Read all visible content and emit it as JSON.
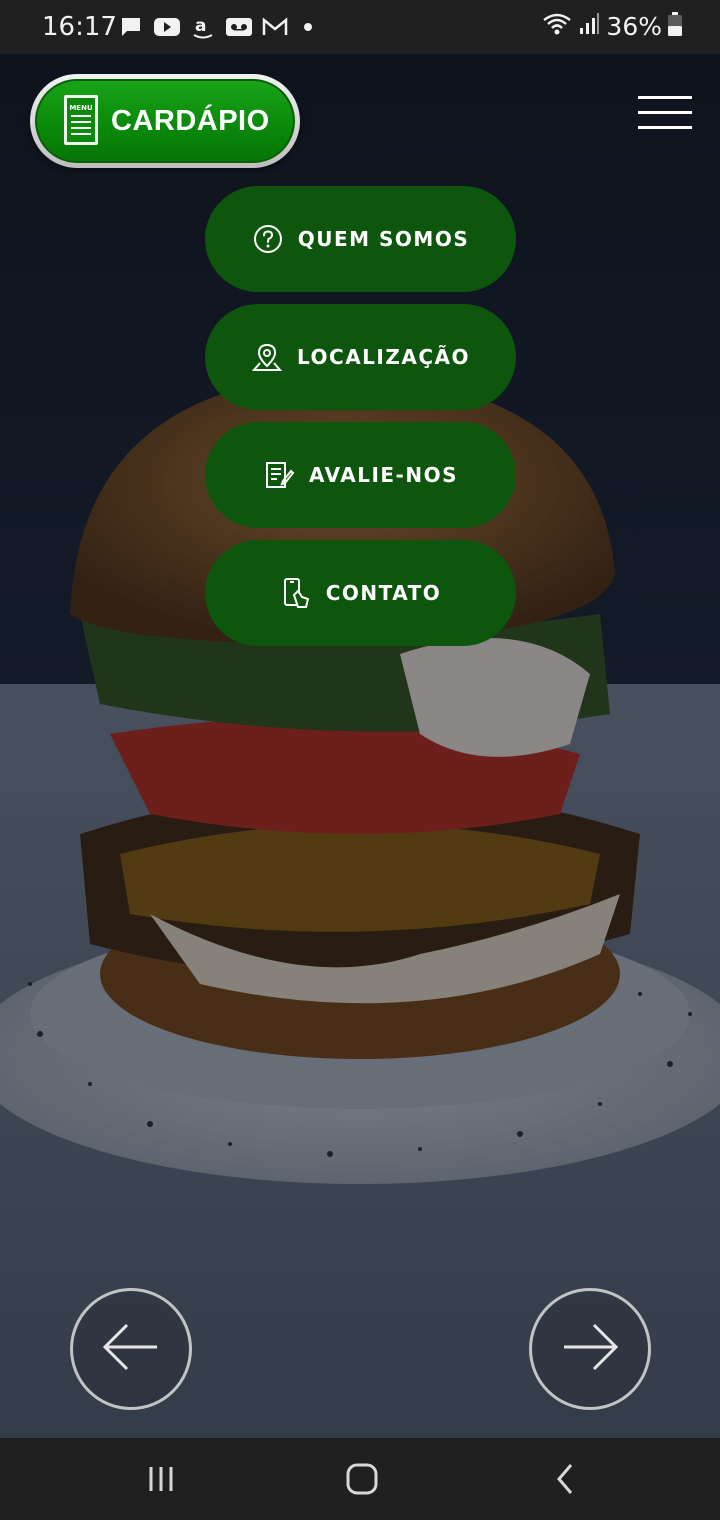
{
  "status_bar": {
    "time": "16:17",
    "battery": "36%",
    "icons": [
      "chat-icon",
      "youtube-icon",
      "amazon-icon",
      "voicemail-icon",
      "gmail-icon",
      "dot-icon",
      "wifi-icon",
      "signal-icon",
      "battery-icon"
    ]
  },
  "header": {
    "logo_badge": "MENU",
    "logo_text": "CARDÁPIO",
    "menu_icon": "hamburger-icon"
  },
  "nav_menu": {
    "items": [
      {
        "label": "QUEM SOMOS",
        "icon": "question-circle-icon"
      },
      {
        "label": "LOCALIZAÇÃO",
        "icon": "map-pin-icon"
      },
      {
        "label": "AVALIE-NOS",
        "icon": "review-edit-icon"
      },
      {
        "label": "CONTATO",
        "icon": "phone-touch-icon"
      }
    ]
  },
  "carousel": {
    "prev_icon": "arrow-left-icon",
    "next_icon": "arrow-right-icon"
  },
  "system_nav": {
    "icons": [
      "recent-apps-icon",
      "home-icon",
      "back-icon"
    ]
  },
  "colors": {
    "button_green": "#0e560e",
    "logo_green": "#0b8a0b",
    "bar_dark": "#202020"
  }
}
